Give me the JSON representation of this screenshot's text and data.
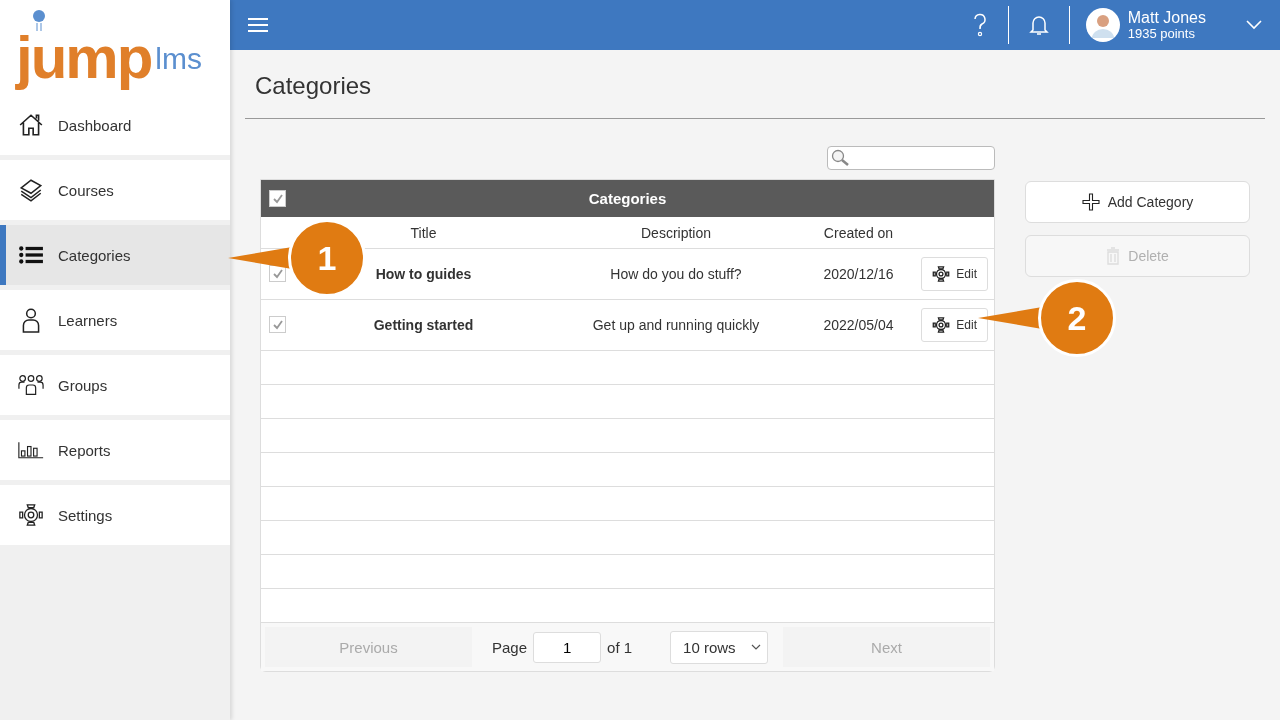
{
  "logo": {
    "main": "jump",
    "suffix": "lms"
  },
  "sidebar": {
    "items": [
      {
        "label": "Dashboard",
        "selected": false
      },
      {
        "label": "Courses",
        "selected": false
      },
      {
        "label": "Categories",
        "selected": true
      },
      {
        "label": "Learners",
        "selected": false
      },
      {
        "label": "Groups",
        "selected": false
      },
      {
        "label": "Reports",
        "selected": false
      },
      {
        "label": "Settings",
        "selected": false
      }
    ]
  },
  "topbar": {
    "user": {
      "name": "Matt Jones",
      "points": "1935 points"
    }
  },
  "page_title": "Categories",
  "table": {
    "title": "Categories",
    "all_checked": true,
    "columns": [
      "Title",
      "Description",
      "Created on"
    ],
    "rows": [
      {
        "title": "How to guides",
        "description": "How do you do stuff?",
        "created": "2020/12/16",
        "action": "Edit",
        "checked": true
      },
      {
        "title": "Getting started",
        "description": "Get up and running quickly",
        "created": "2022/05/04",
        "action": "Edit",
        "checked": true
      }
    ],
    "pagination": {
      "previous": "Previous",
      "page_label": "Page",
      "page": "1",
      "of": "of 1",
      "rows": "10 rows",
      "next": "Next"
    }
  },
  "actions": [
    {
      "label": "Add Category",
      "disabled": false
    },
    {
      "label": "Delete",
      "disabled": true
    }
  ],
  "callouts": [
    {
      "label": "1"
    },
    {
      "label": "2"
    }
  ]
}
